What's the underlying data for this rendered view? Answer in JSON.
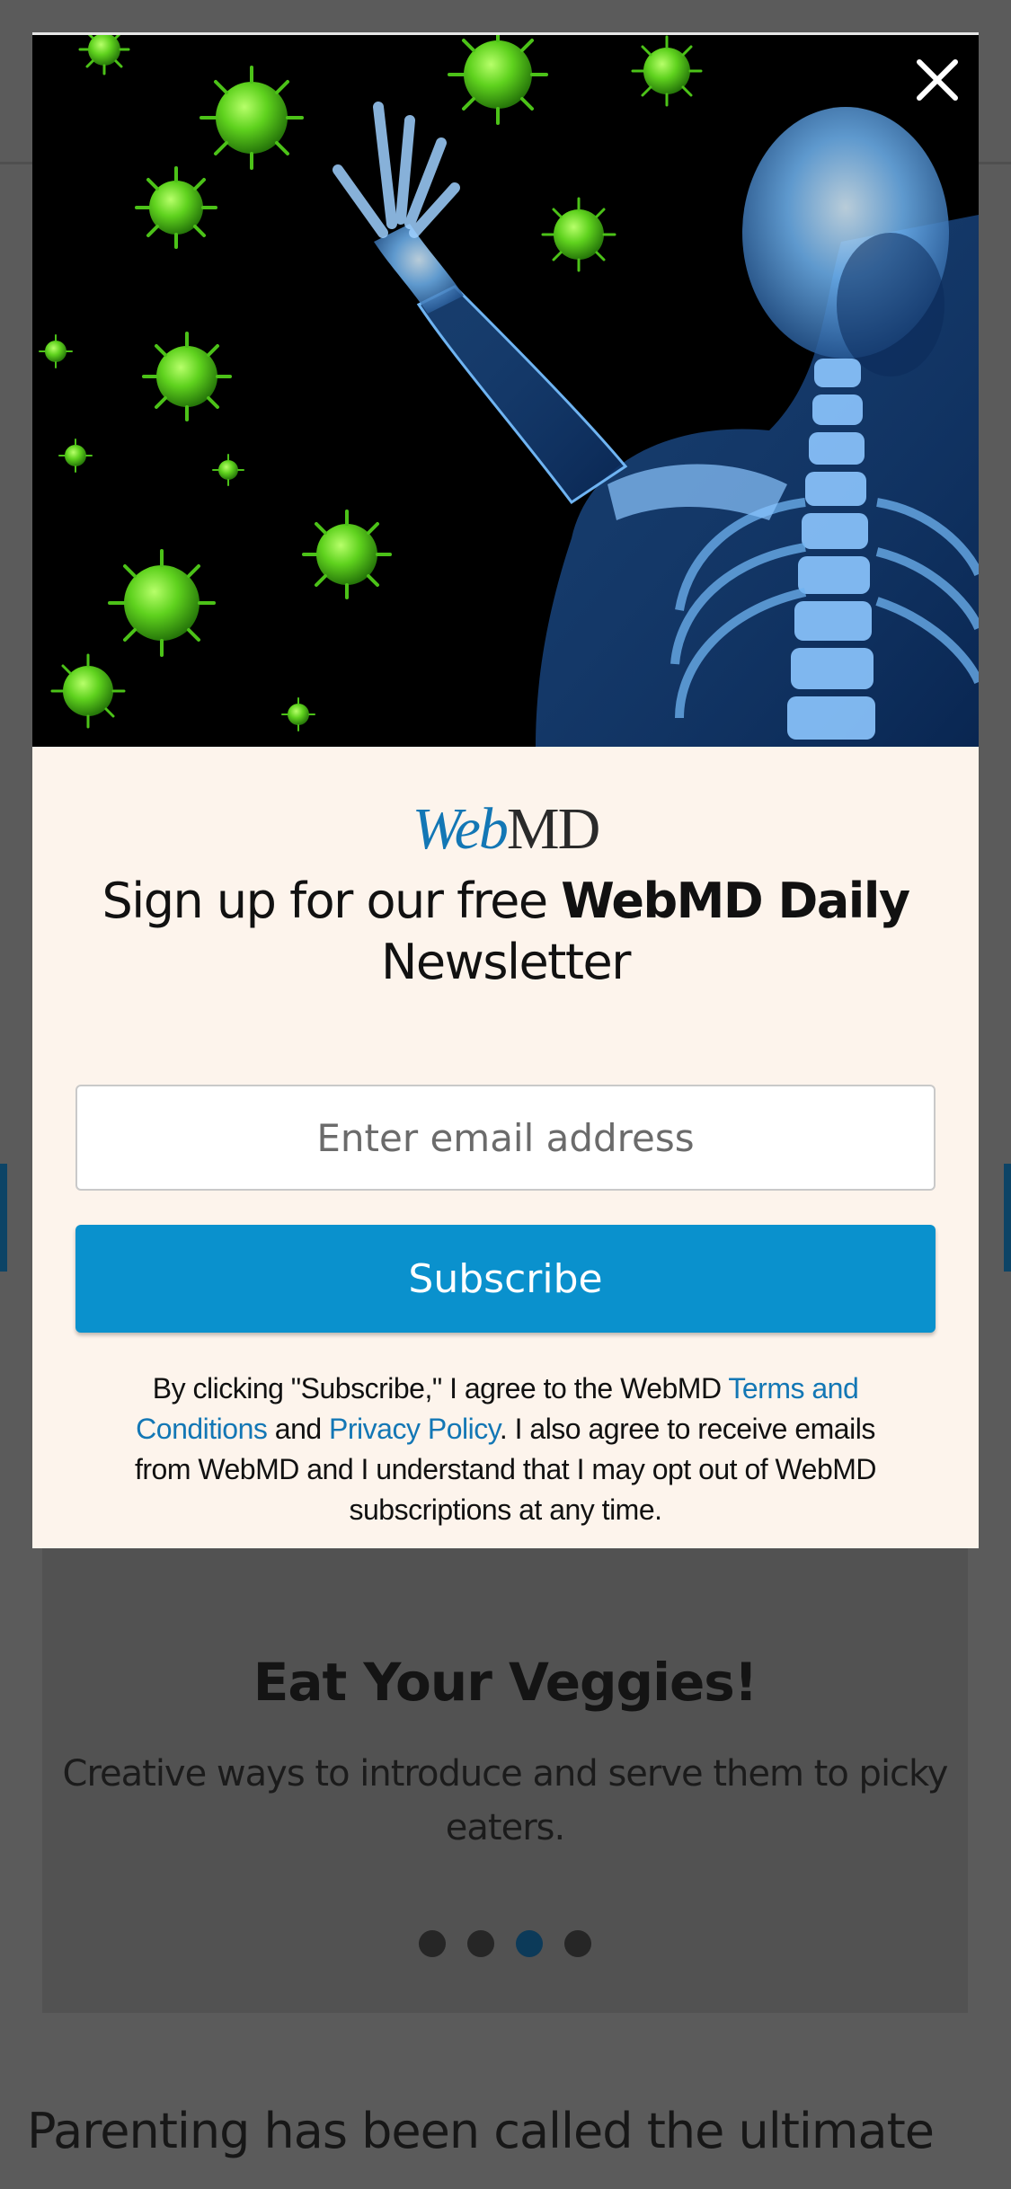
{
  "background": {
    "card": {
      "title": "Eat Your Veggies!",
      "description": "Creative ways to introduce and serve them to picky eaters.",
      "carousel": {
        "count": 4,
        "active_index": 2
      }
    },
    "intro_text": "Parenting has been called the ultimate"
  },
  "modal": {
    "close_icon": "close-icon",
    "hero_image": "virus-and-skeleton-illustration",
    "logo": {
      "web": "Web",
      "md": "MD"
    },
    "headline": {
      "prefix": "Sign up for our free ",
      "bold": "WebMD Daily",
      "suffix": "Newsletter"
    },
    "email": {
      "placeholder": "Enter email address",
      "value": ""
    },
    "subscribe_label": "Subscribe",
    "legal": {
      "part1": "By clicking \"Subscribe,\" I agree to the WebMD ",
      "terms_link": "Terms and Conditions",
      "part2": " and ",
      "privacy_link": "Privacy Policy",
      "part3": ". I also agree to receive emails from WebMD and I understand that I may opt out of WebMD subscriptions at any time."
    }
  },
  "colors": {
    "overlay_background": "#5b5b5b",
    "modal_background": "#fdf4ec",
    "accent_blue": "#0a91cd",
    "link_blue": "#1377b5",
    "virus_green": "#5fd21e",
    "skeleton_blue": "#3e8fe0"
  }
}
